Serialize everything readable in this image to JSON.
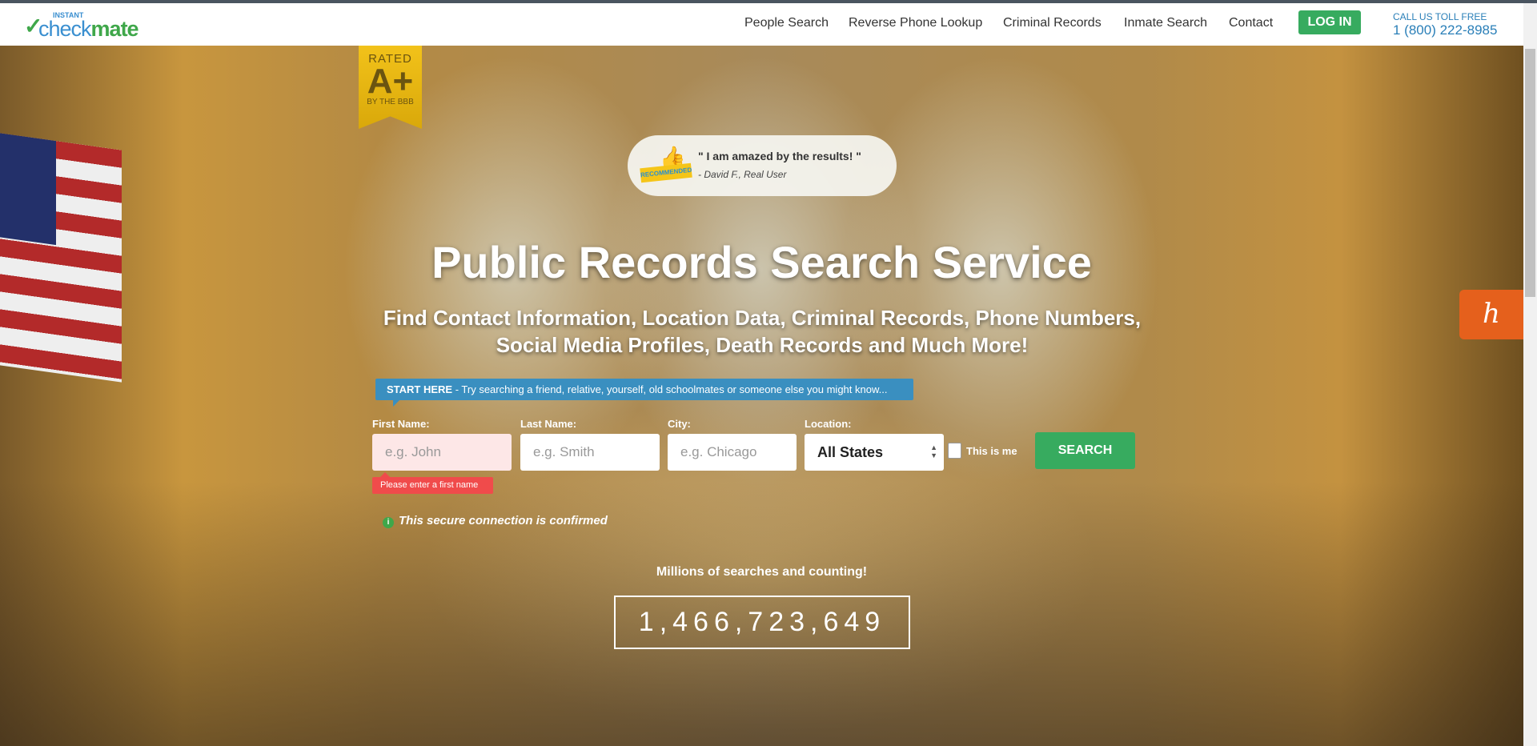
{
  "header": {
    "logo_small": "INSTANT",
    "logo_check": "check",
    "logo_mate": "mate",
    "nav": [
      "People Search",
      "Reverse Phone Lookup",
      "Criminal Records",
      "Inmate Search",
      "Contact"
    ],
    "login": "LOG IN",
    "call_label": "CALL US TOLL FREE",
    "phone": "1 (800) 222-8985"
  },
  "badge": {
    "rated": "RATED",
    "grade": "A+",
    "by": "BY THE BBB"
  },
  "testimonial": {
    "ribbon": "RECOMMENDED",
    "quote": "\" I am amazed by the results! \"",
    "author": "- David F., Real User"
  },
  "hero": {
    "title": "Public Records Search Service",
    "subtitle": "Find Contact Information, Location Data, Criminal Records, Phone Numbers, Social Media Profiles, Death Records and Much More!"
  },
  "form": {
    "start_bold": "START HERE",
    "start_text": " - Try searching a friend, relative, yourself, old schoolmates or someone else you might know...",
    "first_label": "First Name:",
    "first_placeholder": "e.g. John",
    "last_label": "Last Name:",
    "last_placeholder": "e.g. Smith",
    "city_label": "City:",
    "city_placeholder": "e.g. Chicago",
    "location_label": "Location:",
    "location_value": "All States",
    "this_is_me": "This is me",
    "search": "SEARCH",
    "error": "Please enter a first name",
    "secure": "This secure connection is confirmed"
  },
  "stats": {
    "label": "Millions of searches and counting!",
    "count": "1,466,723,649"
  },
  "colors": {
    "green": "#37ab5f",
    "blue": "#3a8fc0",
    "error": "#f04b4b",
    "honey": "#e5601c"
  }
}
